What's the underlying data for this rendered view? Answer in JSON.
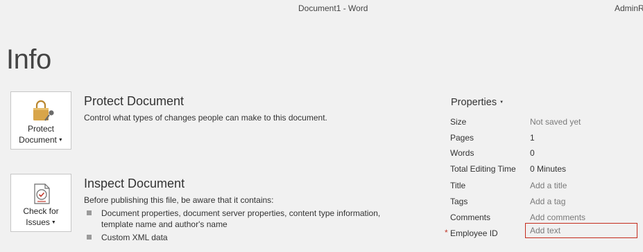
{
  "window": {
    "title": "Document1  -  Word",
    "user": "AdminR"
  },
  "page": {
    "title": "Info"
  },
  "protect": {
    "button_line1": "Protect",
    "button_line2": "Document",
    "heading": "Protect Document",
    "description": "Control what types of changes people can make to this document.",
    "icon": "lock-key-icon"
  },
  "inspect": {
    "button_line1": "Check for",
    "button_line2": "Issues",
    "heading": "Inspect Document",
    "description": "Before publishing this file, be aware that it contains:",
    "items": [
      {
        "line1": "Document properties, document server properties, content type information,",
        "line2": "template name and author's name"
      },
      {
        "line1": "Custom XML data",
        "line2": ""
      }
    ],
    "icon": "document-check-icon"
  },
  "properties": {
    "title": "Properties",
    "rows": [
      {
        "name": "Size",
        "value": "Not saved yet"
      },
      {
        "name": "Pages",
        "value": "1"
      },
      {
        "name": "Words",
        "value": "0"
      },
      {
        "name": "Total Editing Time",
        "value": "0 Minutes"
      },
      {
        "name": "Title",
        "value": "Add a title"
      },
      {
        "name": "Tags",
        "value": "Add a tag"
      },
      {
        "name": "Comments",
        "value": "Add comments"
      },
      {
        "name": "Employee ID",
        "placeholder": "Add text",
        "required_marker": "*"
      }
    ]
  },
  "colors": {
    "background": "#f1f1f1",
    "required_red": "#c42b1c",
    "lock_gold": "#d8a54a"
  }
}
